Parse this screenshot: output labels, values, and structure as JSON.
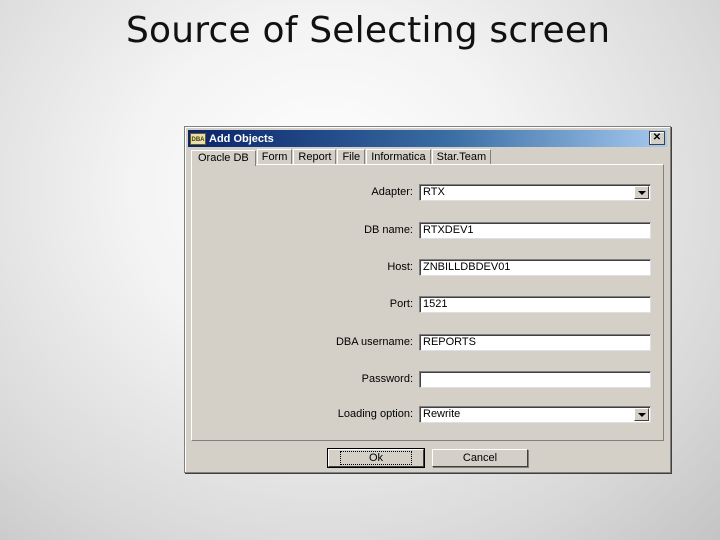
{
  "slide": {
    "title": "Source of Selecting screen"
  },
  "window": {
    "icon_text": "DBA",
    "title": "Add Objects",
    "close_symbol": "✕"
  },
  "tabs": [
    "Oracle DB",
    "Form",
    "Report",
    "File",
    "Informatica",
    "Star.Team"
  ],
  "form": {
    "adapter": {
      "label": "Adapter:",
      "value": "RTX"
    },
    "db_name": {
      "label": "DB name:",
      "value": "RTXDEV1"
    },
    "host": {
      "label": "Host:",
      "value": "ZNBILLDBDEV01"
    },
    "port": {
      "label": "Port:",
      "value": "1521"
    },
    "dba_username": {
      "label": "DBA username:",
      "value": "REPORTS"
    },
    "password": {
      "label": "Password:",
      "value": ""
    },
    "loading_option": {
      "label": "Loading option:",
      "value": "Rewrite"
    }
  },
  "buttons": {
    "ok": "Ok",
    "cancel": "Cancel"
  },
  "icons": {
    "dropdown": "chevron-down-icon",
    "close": "close-icon",
    "app": "app-icon"
  }
}
